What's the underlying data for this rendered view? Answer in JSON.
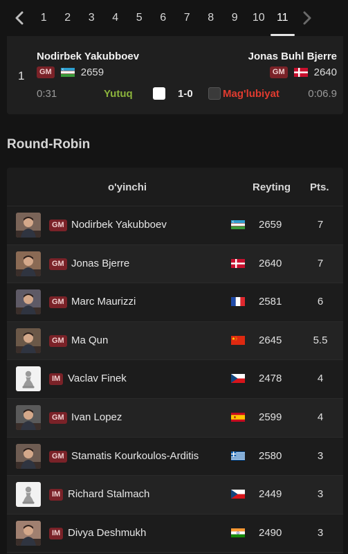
{
  "rounds": {
    "items": [
      "1",
      "2",
      "3",
      "4",
      "5",
      "6",
      "7",
      "8",
      "9",
      "10",
      "11"
    ],
    "active": "11"
  },
  "game": {
    "index": "1",
    "white": {
      "name": "Nodirbek Yakubboev",
      "title": "GM",
      "flag": "uzbekistan",
      "rating": "2659",
      "clock": "0:31"
    },
    "black": {
      "name": "Jonas Buhl Bjerre",
      "title": "GM",
      "flag": "denmark",
      "rating": "2640",
      "clock": "0:06.9"
    },
    "white_result": "Yutuq",
    "score": "1-0",
    "black_result": "Mag'lubiyat"
  },
  "section_title": "Round-Robin",
  "standings": {
    "headers": {
      "player": "o'yinchi",
      "rating": "Reyting",
      "points": "Pts."
    },
    "rows": [
      {
        "title": "GM",
        "name": "Nodirbek Yakubboev",
        "flag": "uzbekistan",
        "rating": "2659",
        "points": "7",
        "avatar": "photo"
      },
      {
        "title": "GM",
        "name": "Jonas Bjerre",
        "flag": "denmark",
        "rating": "2640",
        "points": "7",
        "avatar": "photo"
      },
      {
        "title": "GM",
        "name": "Marc Maurizzi",
        "flag": "france",
        "rating": "2581",
        "points": "6",
        "avatar": "photo"
      },
      {
        "title": "GM",
        "name": "Ma Qun",
        "flag": "china",
        "rating": "2645",
        "points": "5.5",
        "avatar": "photo"
      },
      {
        "title": "IM",
        "name": "Vaclav Finek",
        "flag": "czechia",
        "rating": "2478",
        "points": "4",
        "avatar": "pawn"
      },
      {
        "title": "GM",
        "name": "Ivan Lopez",
        "flag": "spain",
        "rating": "2599",
        "points": "4",
        "avatar": "photo"
      },
      {
        "title": "GM",
        "name": "Stamatis Kourkoulos-Arditis",
        "flag": "greece",
        "rating": "2580",
        "points": "3",
        "avatar": "photo"
      },
      {
        "title": "IM",
        "name": "Richard Stalmach",
        "flag": "czechia",
        "rating": "2449",
        "points": "3",
        "avatar": "pawn"
      },
      {
        "title": "IM",
        "name": "Divya Deshmukh",
        "flag": "india",
        "rating": "2490",
        "points": "3",
        "avatar": "photo"
      }
    ]
  },
  "colors": {
    "win": "#8bb33c",
    "loss": "#e03b2f",
    "title_badge": "#7a2228"
  },
  "icons": {
    "prev": "chevron-left-icon",
    "next": "chevron-right-icon"
  }
}
